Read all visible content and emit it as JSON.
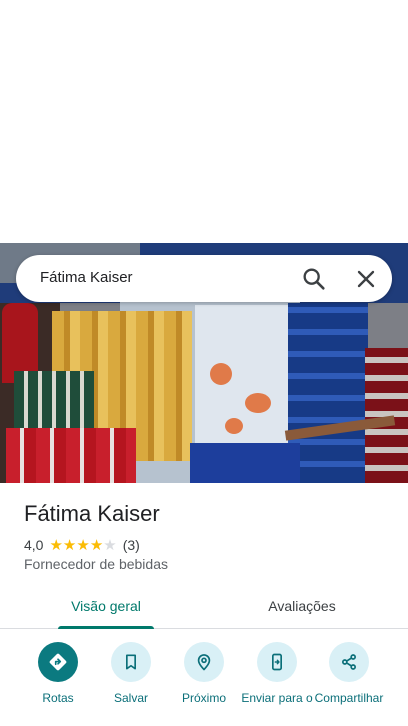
{
  "search": {
    "query": "Fátima Kaiser"
  },
  "icons": {
    "search": "search-icon",
    "close": "close-icon",
    "directions": "directions-icon",
    "save": "bookmark-icon",
    "nearby": "nearby-icon",
    "send": "send-to-phone-icon",
    "share": "share-icon"
  },
  "place": {
    "name": "Fátima Kaiser",
    "rating": "4,0",
    "rating_stars": 4,
    "reviews_count": "(3)",
    "category": "Fornecedor de bebidas"
  },
  "tabs": [
    {
      "label": "Visão geral",
      "active": true
    },
    {
      "label": "Avaliações",
      "active": false
    }
  ],
  "actions": [
    {
      "label": "Rotas"
    },
    {
      "label": "Salvar"
    },
    {
      "label": "Próximo"
    },
    {
      "label": "Enviar para o"
    },
    {
      "label": "Compartilhar"
    }
  ],
  "colors": {
    "accent": "#00796b",
    "action_primary": "#0b7a80",
    "action_bg": "#d9f0f6",
    "star": "#fbbc04"
  }
}
